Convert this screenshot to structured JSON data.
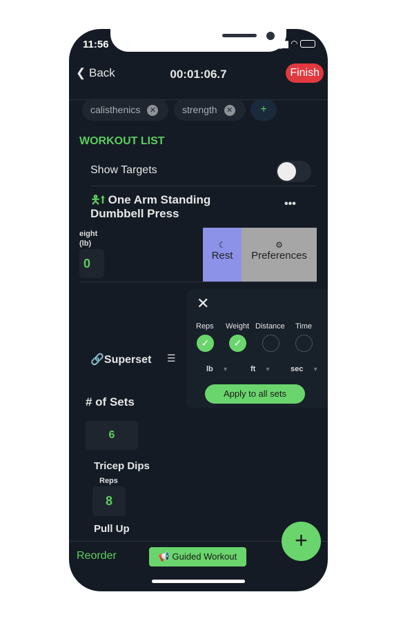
{
  "status": {
    "time": "11:56"
  },
  "header": {
    "back": "Back",
    "timer": "00:01:06.7",
    "finish": "Finish"
  },
  "tags": [
    {
      "label": "calisthenics"
    },
    {
      "label": "strength"
    }
  ],
  "add_tag": "+",
  "section_title": "WORKOUT LIST",
  "show_targets": {
    "label": "Show Targets",
    "on": false
  },
  "exercise": {
    "title_line1": "One Arm Standing",
    "title_line2": "Dumbbell Press",
    "weight_label_1": "eight",
    "weight_label_2": "(lb)",
    "weight_value": "0"
  },
  "swipe_actions": {
    "rest": "Rest",
    "preferences": "Preferences",
    "rest_color": "#8b92e8",
    "preferences_color": "#a6a6a6"
  },
  "popup": {
    "close": "✕",
    "columns": [
      {
        "label": "Reps",
        "checked": true,
        "unit": ""
      },
      {
        "label": "Weight",
        "checked": true,
        "unit": "lb"
      },
      {
        "label": "Distance",
        "checked": false,
        "unit": "ft"
      },
      {
        "label": "Time",
        "checked": false,
        "unit": "sec"
      }
    ],
    "apply": "Apply to all sets"
  },
  "superset": {
    "label": "Superset",
    "sets_label": "# of Sets",
    "sets_value": "6"
  },
  "exercises": [
    {
      "name": "Tricep Dips",
      "reps_label": "Reps",
      "reps_value": "8"
    },
    {
      "name": "Pull Up"
    }
  ],
  "bottom": {
    "reorder": "Reorder",
    "guided": "Guided Workout",
    "fab": "+"
  },
  "colors": {
    "accent": "#5ccc5e",
    "finish": "#e0393e",
    "background": "#141b24"
  }
}
